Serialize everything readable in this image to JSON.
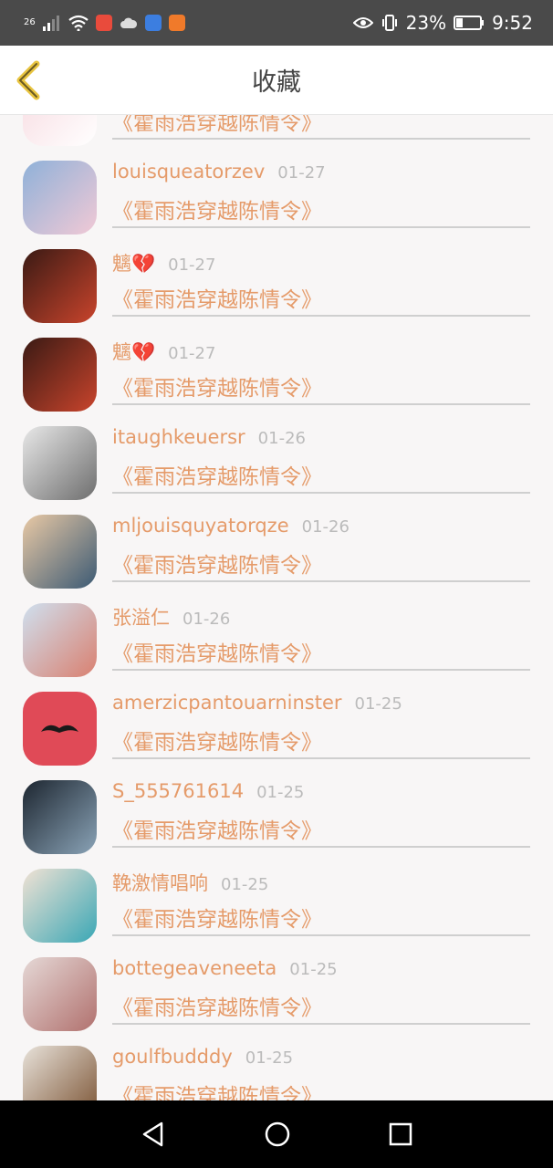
{
  "status": {
    "network": "26",
    "battery": "23%",
    "time": "9:52"
  },
  "header": {
    "title": "收藏"
  },
  "favorites": [
    {
      "user": "",
      "date": "",
      "song": "《霍雨浩穿越陈情令》",
      "avatar_bg": "#f7d9df",
      "avatar_fg": "#ffffff"
    },
    {
      "user": "louisqueatorzev",
      "date": "01-27",
      "song": "《霍雨浩穿越陈情令》",
      "avatar_bg": "#8fb1d8",
      "avatar_fg": "#f1c9d6"
    },
    {
      "user": "魑💔",
      "date": "01-27",
      "song": "《霍雨浩穿越陈情令》",
      "avatar_bg": "#3a1a14",
      "avatar_fg": "#c9442c"
    },
    {
      "user": "魑💔",
      "date": "01-27",
      "song": "《霍雨浩穿越陈情令》",
      "avatar_bg": "#3a1a14",
      "avatar_fg": "#c9442c"
    },
    {
      "user": "itaughkeuersr",
      "date": "01-26",
      "song": "《霍雨浩穿越陈情令》",
      "avatar_bg": "#e8e8e8",
      "avatar_fg": "#6e6e6e"
    },
    {
      "user": "mljouisquyatorqze",
      "date": "01-26",
      "song": "《霍雨浩穿越陈情令》",
      "avatar_bg": "#e9c9a5",
      "avatar_fg": "#3c5a74"
    },
    {
      "user": "张溢仁",
      "date": "01-26",
      "song": "《霍雨浩穿越陈情令》",
      "avatar_bg": "#cfe0ef",
      "avatar_fg": "#d98070"
    },
    {
      "user": "amerzicpantouarninster",
      "date": "01-25",
      "song": "《霍雨浩穿越陈情令》",
      "avatar_bg": "#e04a57",
      "avatar_fg": "#1a1a1a"
    },
    {
      "user": "S_555761614",
      "date": "01-25",
      "song": "《霍雨浩穿越陈情令》",
      "avatar_bg": "#1d2630",
      "avatar_fg": "#8aa3b7"
    },
    {
      "user": "鞔激情唱响",
      "date": "01-25",
      "song": "《霍雨浩穿越陈情令》",
      "avatar_bg": "#f1e2d4",
      "avatar_fg": "#3aa7b5"
    },
    {
      "user": "bottegeaveneeta",
      "date": "01-25",
      "song": "《霍雨浩穿越陈情令》",
      "avatar_bg": "#e5d8d6",
      "avatar_fg": "#b1716e"
    },
    {
      "user": "goulfbudddy",
      "date": "01-25",
      "song": "《霍雨浩穿越陈情令》",
      "avatar_bg": "#e8e2da",
      "avatar_fg": "#7a5232"
    }
  ]
}
